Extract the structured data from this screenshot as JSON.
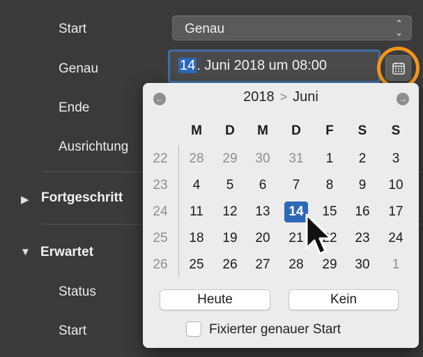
{
  "form": {
    "start_label": "Start",
    "start_value": "Genau",
    "genau_label": "Genau",
    "date_day": "14",
    "date_rest": ". Juni 2018 um 08:00",
    "ende_label": "Ende",
    "ausrichtung_label": "Ausrichtung",
    "fortgeschritten_label": "Fortgeschritt",
    "erwartet_label": "Erwartet",
    "status_label": "Status",
    "start2_label": "Start"
  },
  "calendar": {
    "year": "2018",
    "month": "Juni",
    "weekdays": [
      "M",
      "D",
      "M",
      "D",
      "F",
      "S",
      "S"
    ],
    "weeks": [
      {
        "wk": "22",
        "days": [
          "28",
          "29",
          "30",
          "31",
          "1",
          "2",
          "3"
        ]
      },
      {
        "wk": "23",
        "days": [
          "4",
          "5",
          "6",
          "7",
          "8",
          "9",
          "10"
        ]
      },
      {
        "wk": "24",
        "days": [
          "11",
          "12",
          "13",
          "14",
          "15",
          "16",
          "17"
        ]
      },
      {
        "wk": "25",
        "days": [
          "18",
          "19",
          "20",
          "21",
          "22",
          "23",
          "24"
        ]
      },
      {
        "wk": "26",
        "days": [
          "25",
          "26",
          "27",
          "28",
          "29",
          "30",
          "1"
        ]
      }
    ],
    "selected_day": "14",
    "today_button": "Heute",
    "none_button": "Kein",
    "checkbox_label": "Fixierter genauer Start",
    "checkbox_checked": false
  },
  "colors": {
    "accent": "#2e68b8",
    "highlight_ring": "#f5951b",
    "background": "#3a3a3a"
  }
}
